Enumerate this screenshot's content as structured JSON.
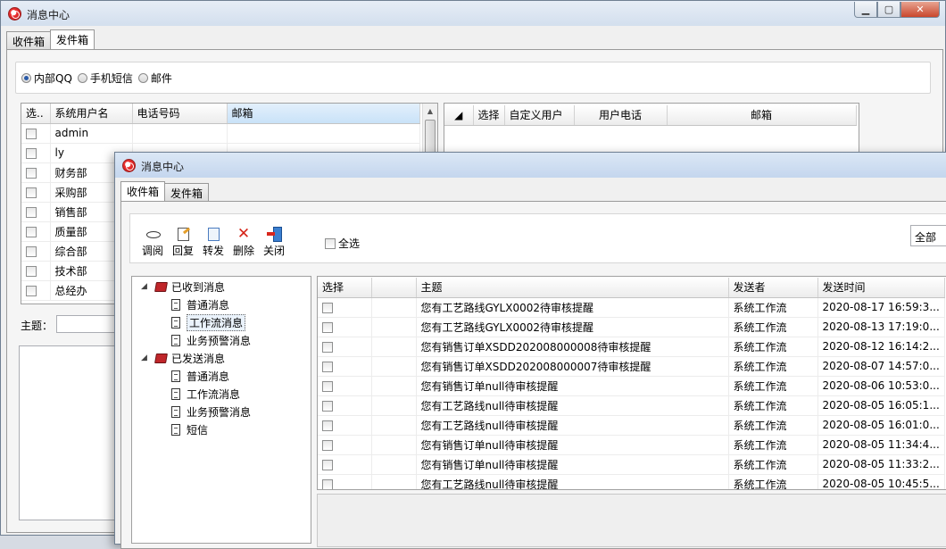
{
  "back_window": {
    "title": "消息中心",
    "tabs": [
      {
        "label": "收件箱",
        "active": false
      },
      {
        "label": "发件箱",
        "active": true
      }
    ],
    "send_modes": [
      {
        "label": "内部QQ",
        "selected": true
      },
      {
        "label": "手机短信",
        "selected": false
      },
      {
        "label": "邮件",
        "selected": false
      }
    ],
    "user_grid": {
      "columns": [
        "选..",
        "系统用户名",
        "电话号码",
        "邮箱"
      ],
      "rows": [
        "admin",
        "ly",
        "财务部",
        "采购部",
        "销售部",
        "质量部",
        "综合部",
        "技术部",
        "总经办"
      ]
    },
    "recipient_grid": {
      "columns": [
        "选择",
        "自定义用户",
        "用户电话",
        "邮箱"
      ]
    },
    "subject_label": "主题："
  },
  "front_window": {
    "title": "消息中心",
    "tabs": [
      {
        "label": "收件箱",
        "active": true
      },
      {
        "label": "发件箱",
        "active": false
      }
    ],
    "toolbar": {
      "read": "调阅",
      "reply": "回复",
      "forward": "转发",
      "delete": "删除",
      "close": "关闭"
    },
    "select_all_label": "全选",
    "filter_value": "全部",
    "tree": {
      "received": {
        "label": "已收到消息",
        "children": [
          "普通消息",
          "工作流消息",
          "业务预警消息"
        ]
      },
      "sent": {
        "label": "已发送消息",
        "children": [
          "普通消息",
          "工作流消息",
          "业务预警消息",
          "短信"
        ]
      }
    },
    "message_grid": {
      "columns": [
        "选择",
        "主题",
        "发送者",
        "发送时间"
      ],
      "rows": [
        {
          "subject": "您有工艺路线GYLX0002待审核提醒",
          "sender": "系统工作流",
          "time": "2020-08-17 16:59:3..."
        },
        {
          "subject": "您有工艺路线GYLX0002待审核提醒",
          "sender": "系统工作流",
          "time": "2020-08-13 17:19:0..."
        },
        {
          "subject": "您有销售订单XSDD202008000008待审核提醒",
          "sender": "系统工作流",
          "time": "2020-08-12 16:14:2..."
        },
        {
          "subject": "您有销售订单XSDD202008000007待审核提醒",
          "sender": "系统工作流",
          "time": "2020-08-07 14:57:0..."
        },
        {
          "subject": "您有销售订单null待审核提醒",
          "sender": "系统工作流",
          "time": "2020-08-06 10:53:0..."
        },
        {
          "subject": "您有工艺路线null待审核提醒",
          "sender": "系统工作流",
          "time": "2020-08-05 16:05:1..."
        },
        {
          "subject": "您有工艺路线null待审核提醒",
          "sender": "系统工作流",
          "time": "2020-08-05 16:01:0..."
        },
        {
          "subject": "您有销售订单null待审核提醒",
          "sender": "系统工作流",
          "time": "2020-08-05 11:34:4..."
        },
        {
          "subject": "您有销售订单null待审核提醒",
          "sender": "系统工作流",
          "time": "2020-08-05 11:33:2..."
        },
        {
          "subject": "您有工艺路线null待审核提醒",
          "sender": "系统工作流",
          "time": "2020-08-05 10:45:5..."
        }
      ]
    }
  }
}
